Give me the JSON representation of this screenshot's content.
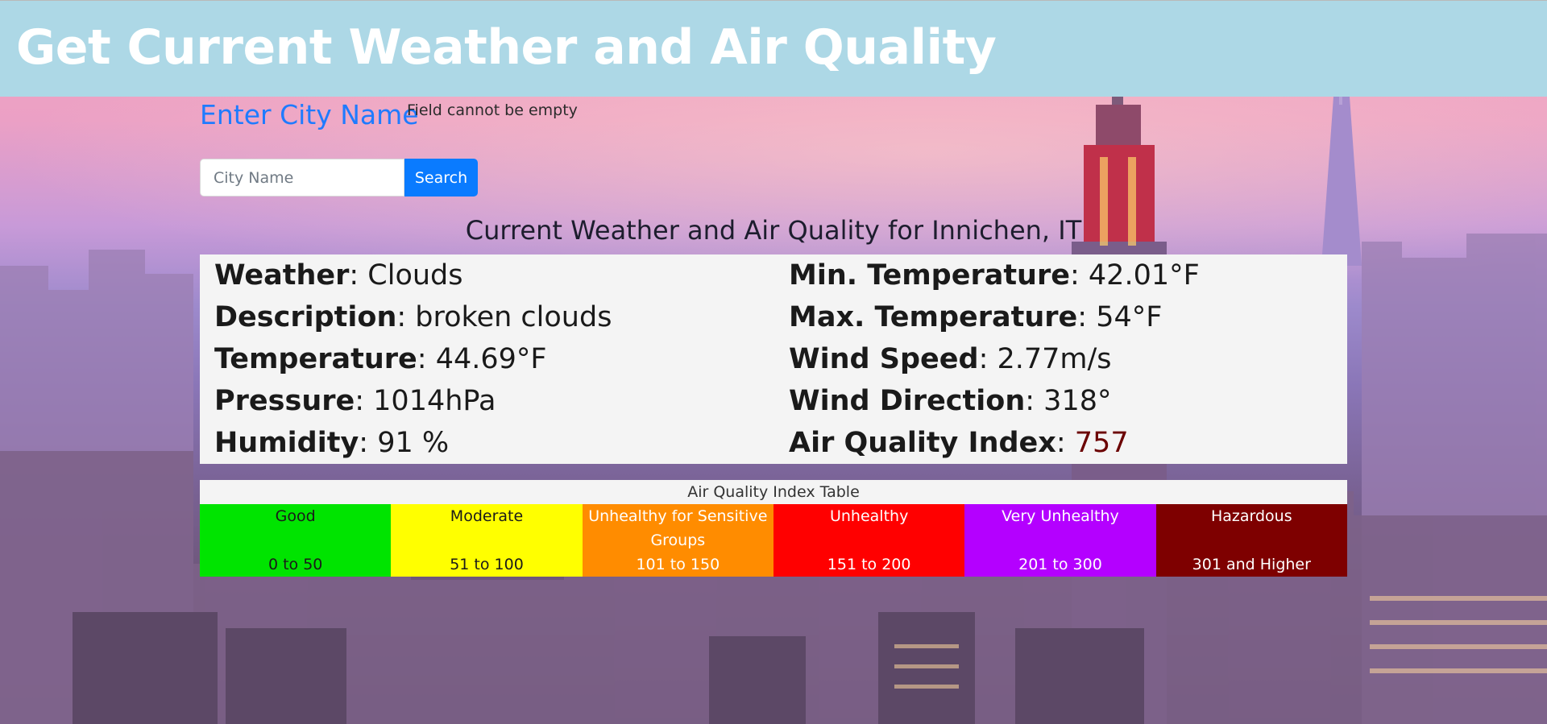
{
  "header": {
    "title": "Get Current Weather and Air Quality"
  },
  "search": {
    "heading": "Enter City Name",
    "error": "Field cannot be empty",
    "placeholder": "City Name",
    "value": "",
    "button_label": "Search"
  },
  "result": {
    "title": "Current Weather and Air Quality for Innichen, IT"
  },
  "weather": {
    "left": [
      {
        "label": "Weather",
        "value": "Clouds"
      },
      {
        "label": "Description",
        "value": "broken clouds"
      },
      {
        "label": "Temperature",
        "value": "44.69°F"
      },
      {
        "label": "Pressure",
        "value": "1014hPa"
      },
      {
        "label": "Humidity",
        "value": "91 %"
      }
    ],
    "right": [
      {
        "label": "Min. Temperature",
        "value": "42.01°F"
      },
      {
        "label": "Max. Temperature",
        "value": "54°F"
      },
      {
        "label": "Wind Speed",
        "value": "2.77m/s"
      },
      {
        "label": "Wind Direction",
        "value": "318°"
      },
      {
        "label": "Air Quality Index",
        "value": "757"
      }
    ]
  },
  "aqi_table": {
    "caption": "Air Quality Index Table",
    "levels": [
      {
        "label": "Good",
        "range": "0 to 50",
        "bg": "#00e400",
        "fg": "#1a1a1a"
      },
      {
        "label": "Moderate",
        "range": "51 to 100",
        "bg": "#ffff00",
        "fg": "#1a1a1a"
      },
      {
        "label": "Unhealthy for Sensitive Groups",
        "range": "101 to 150",
        "bg": "#ff8c00",
        "fg": "#ffffff"
      },
      {
        "label": "Unhealthy",
        "range": "151 to 200",
        "bg": "#ff0000",
        "fg": "#ffffff"
      },
      {
        "label": "Very Unhealthy",
        "range": "201 to 300",
        "bg": "#b400ff",
        "fg": "#ffffff"
      },
      {
        "label": "Hazardous",
        "range": "301 and Higher",
        "bg": "#7e0000",
        "fg": "#ffffff"
      }
    ]
  },
  "colors": {
    "header_bg": "#add8e6",
    "accent": "#0a7bff",
    "aqi_value": "#6b0000"
  }
}
